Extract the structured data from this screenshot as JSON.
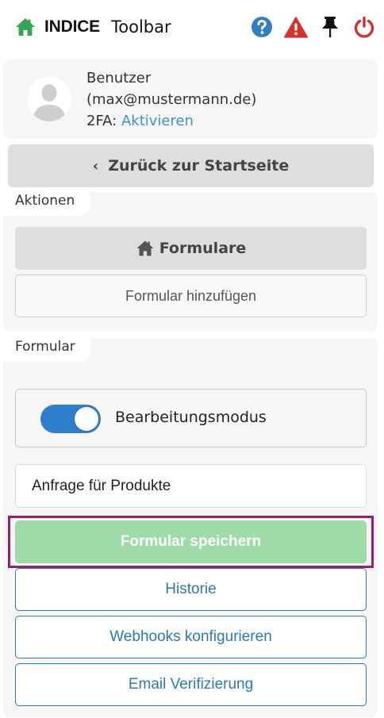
{
  "header": {
    "brand": "INDICE",
    "title": "Toolbar",
    "icons": [
      "home-icon",
      "help-icon",
      "warning-icon",
      "pin-icon",
      "power-icon"
    ]
  },
  "user": {
    "label": "Benutzer",
    "email": "(max@mustermann.de)",
    "twofa_label": "2FA:",
    "twofa_link": "Aktivieren"
  },
  "back_button": {
    "chevron": "‹",
    "label": "Zurück zur Startseite"
  },
  "actions": {
    "title": "Aktionen",
    "forms_button": "Formulare",
    "add_button": "Formular hinzufügen"
  },
  "form": {
    "title": "Formular",
    "edit_mode_label": "Bearbeitungsmodus",
    "edit_mode_on": true,
    "name_value": "Anfrage für Produkte",
    "save_button": "Formular speichern",
    "history_button": "Historie",
    "webhooks_button": "Webhooks konfigurieren",
    "email_button": "Email Verifizierung"
  },
  "colors": {
    "home_green": "#2fa84f",
    "help_blue": "#2f7fc8",
    "danger_red": "#d9302a",
    "link_blue": "#3f8fd2",
    "toggle_blue": "#2e7fcc",
    "save_green": "#9ddca9",
    "outline_blue": "#2b79b4",
    "highlight_purple": "#9b1f6e"
  }
}
